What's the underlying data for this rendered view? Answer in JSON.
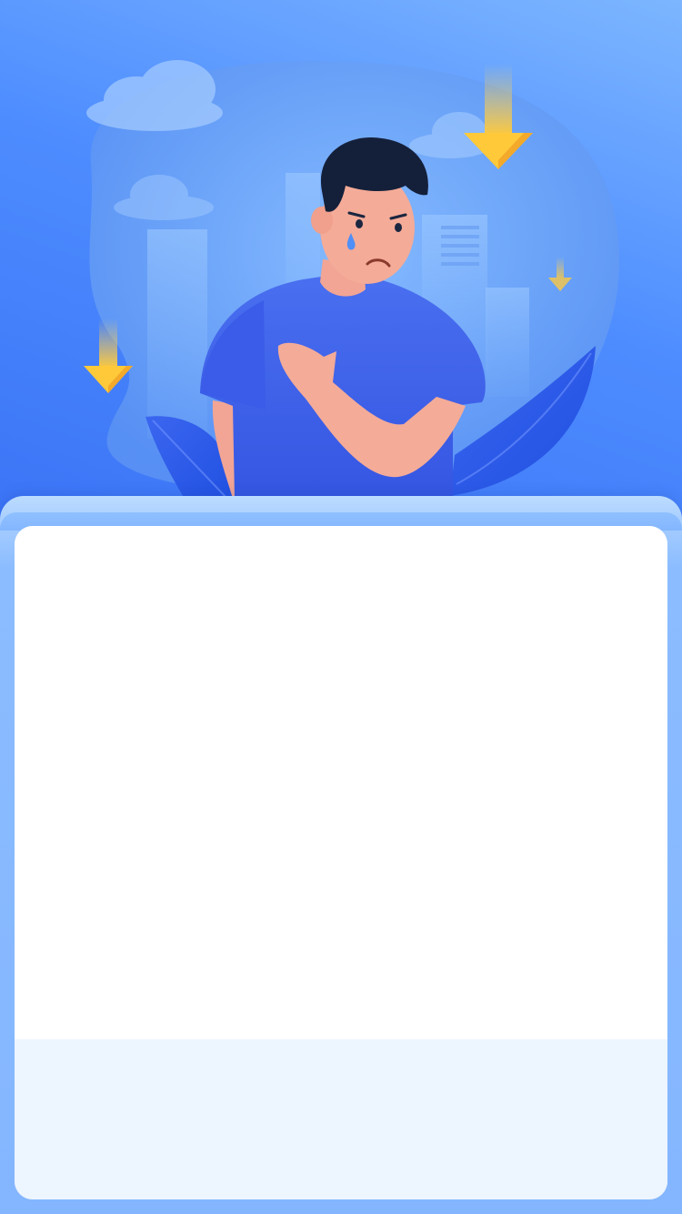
{
  "colors": {
    "background_top": "#7cb6ff",
    "background_main": "#3a72f5",
    "card_frame": "#8bbcff",
    "card_body": "#ffffff",
    "card_footer": "#edf5fe",
    "arrow_yellow": "#ffc93a",
    "shirt_blue": "#3f61ea"
  },
  "illustration": {
    "icons": [
      "cloud-icon",
      "building-icon",
      "arrow-down-icon",
      "leaf-icon",
      "sad-person-icon"
    ]
  },
  "card": {
    "body_text": "",
    "footer_text": ""
  }
}
